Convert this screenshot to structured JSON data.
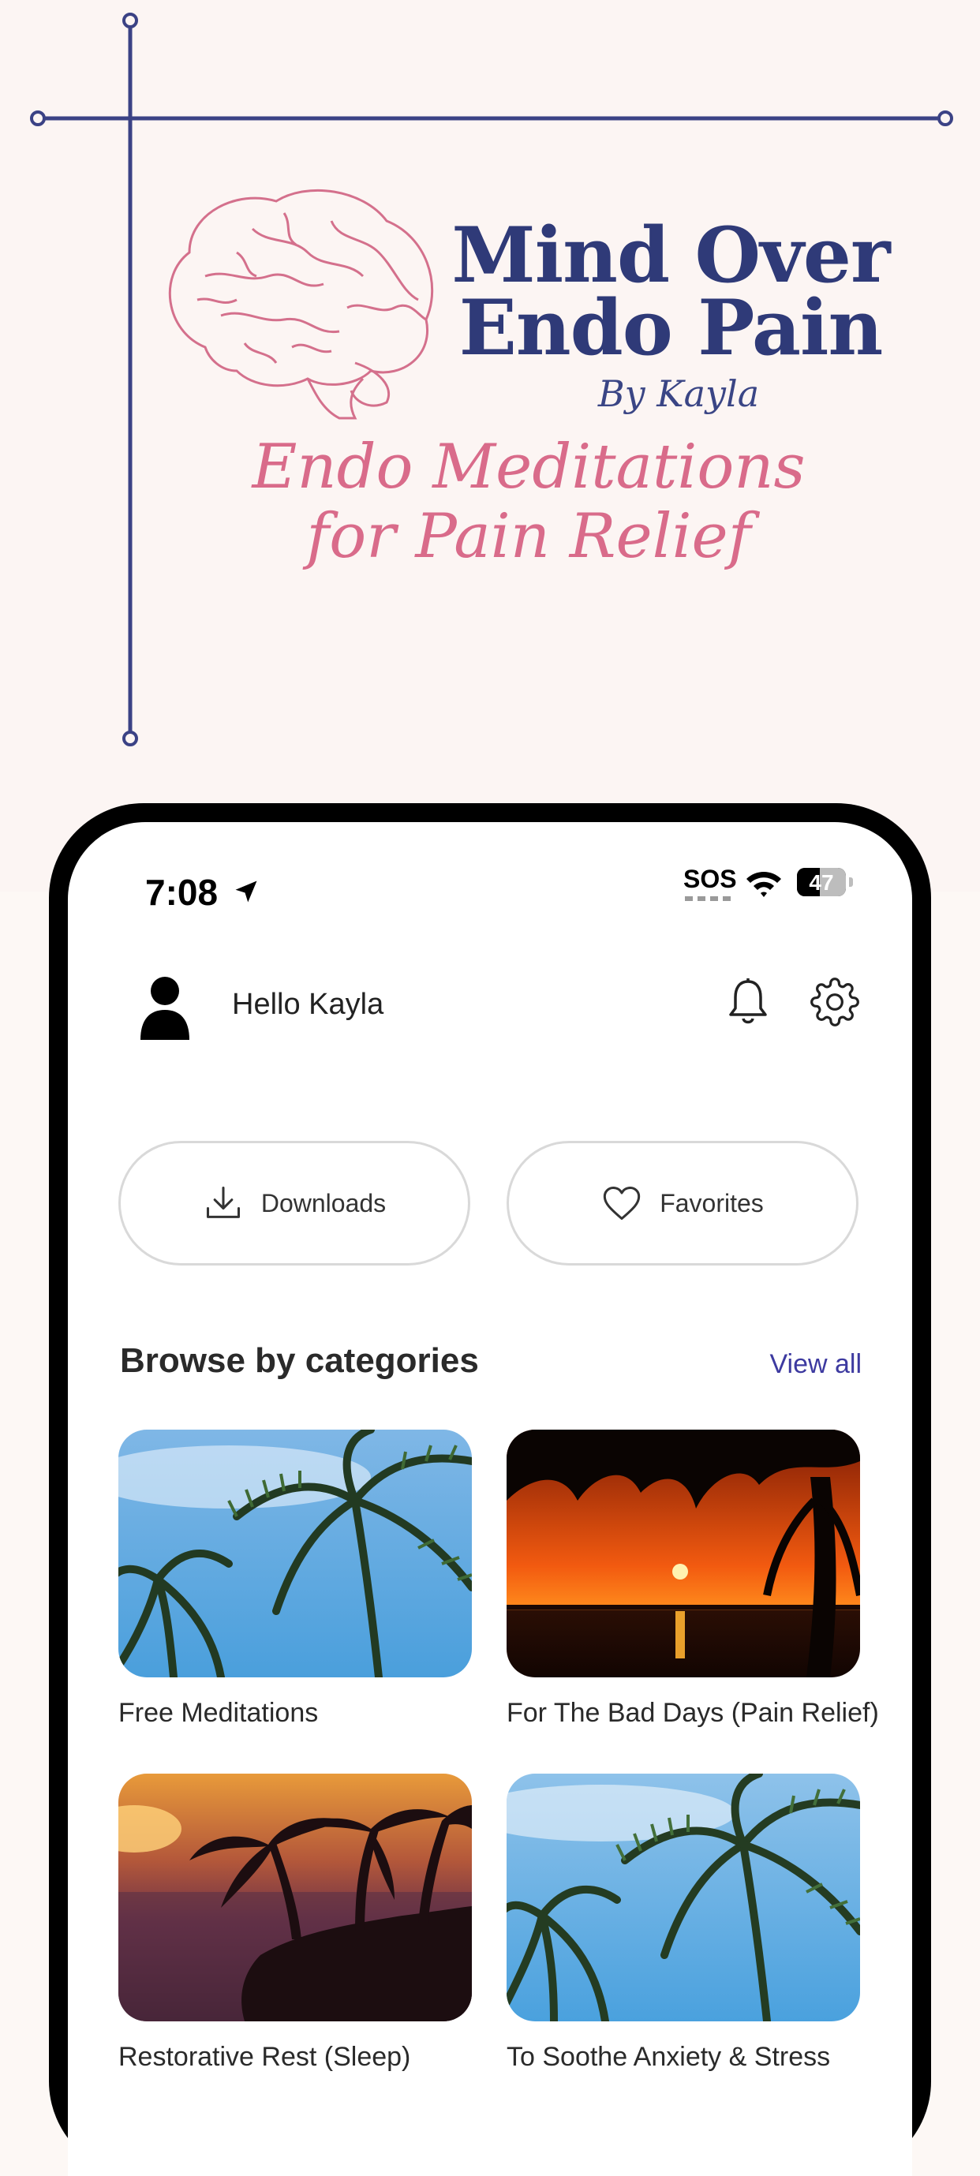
{
  "brand": {
    "title_line1": "Mind Over",
    "title_line2": "Endo Pain",
    "byline": "By Kayla",
    "tagline_line1": "Endo Meditations",
    "tagline_line2": "for Pain Relief"
  },
  "status_bar": {
    "time": "7:08",
    "sos": "SOS",
    "battery_text": "47",
    "battery_level": 0.47
  },
  "header": {
    "greeting": "Hello Kayla"
  },
  "quick_actions": {
    "downloads_label": "Downloads",
    "favorites_label": "Favorites"
  },
  "categories": {
    "section_title": "Browse by categories",
    "view_all_label": "View all",
    "items": [
      {
        "label": "Free Meditations"
      },
      {
        "label": "For The Bad Days (Pain Relief)"
      },
      {
        "label": "Restorative Rest (Sleep)"
      },
      {
        "label": "To Soothe Anxiety & Stress"
      }
    ]
  },
  "colors": {
    "brand_navy": "#2f3a78",
    "brand_pink": "#d96b8a",
    "link": "#3d3aa0"
  }
}
